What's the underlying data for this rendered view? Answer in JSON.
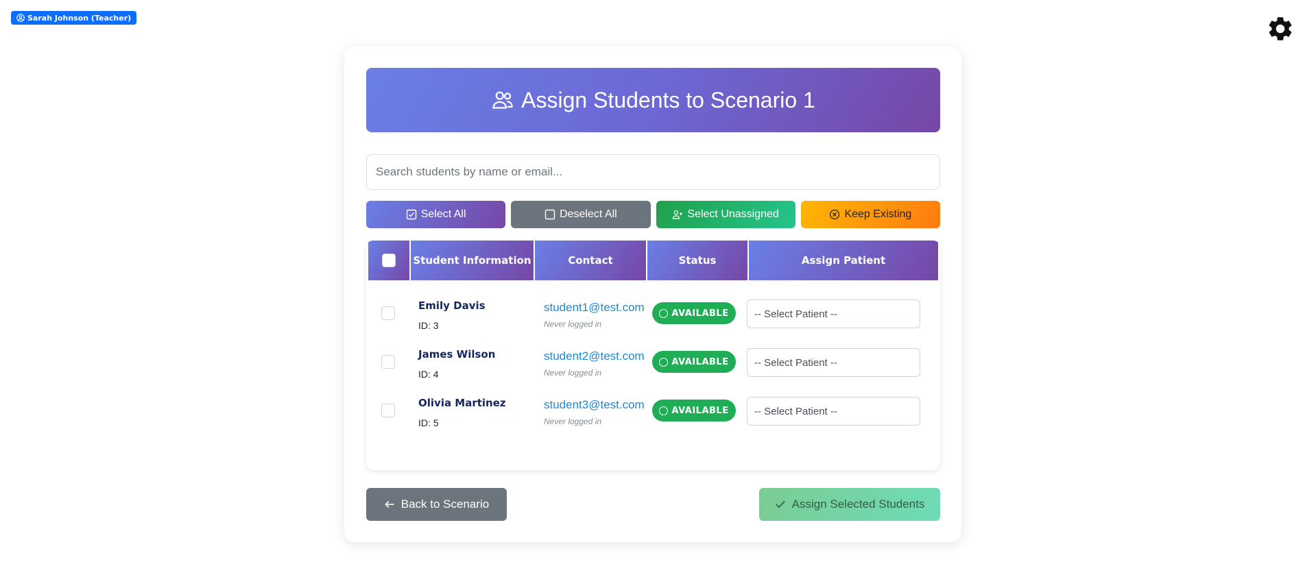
{
  "user_badge": {
    "label": "Sarah Johnson (Teacher)",
    "icon": "user-circle-icon"
  },
  "settings": {
    "icon": "gear-icon"
  },
  "banner": {
    "title": "Assign Students to Scenario 1",
    "icon": "users-icon"
  },
  "search": {
    "placeholder": "Search students by name or email...",
    "value": ""
  },
  "bulk_actions": {
    "select_all": "Select All",
    "deselect_all": "Deselect All",
    "select_unassigned": "Select Unassigned",
    "keep_existing": "Keep Existing"
  },
  "table": {
    "headers": [
      "Student Information",
      "Contact",
      "Status",
      "Assign Patient"
    ],
    "rows": [
      {
        "name": "Emily Davis",
        "id": "ID: 3",
        "email": "student1@test.com",
        "last_login": "Never logged in",
        "status": "AVAILABLE",
        "patient": "-- Select Patient --"
      },
      {
        "name": "James Wilson",
        "id": "ID: 4",
        "email": "student2@test.com",
        "last_login": "Never logged in",
        "status": "AVAILABLE",
        "patient": "-- Select Patient --"
      },
      {
        "name": "Olivia Martinez",
        "id": "ID: 5",
        "email": "student3@test.com",
        "last_login": "Never logged in",
        "status": "AVAILABLE",
        "patient": "-- Select Patient --"
      }
    ]
  },
  "footer": {
    "back_label": "Back to Scenario",
    "assign_label": "Assign Selected Students"
  },
  "colors": {
    "primary_gradient_start": "#6a7fe6",
    "primary_gradient_end": "#7647a6",
    "status_available": "#1fad55",
    "link": "#1e88d6"
  }
}
